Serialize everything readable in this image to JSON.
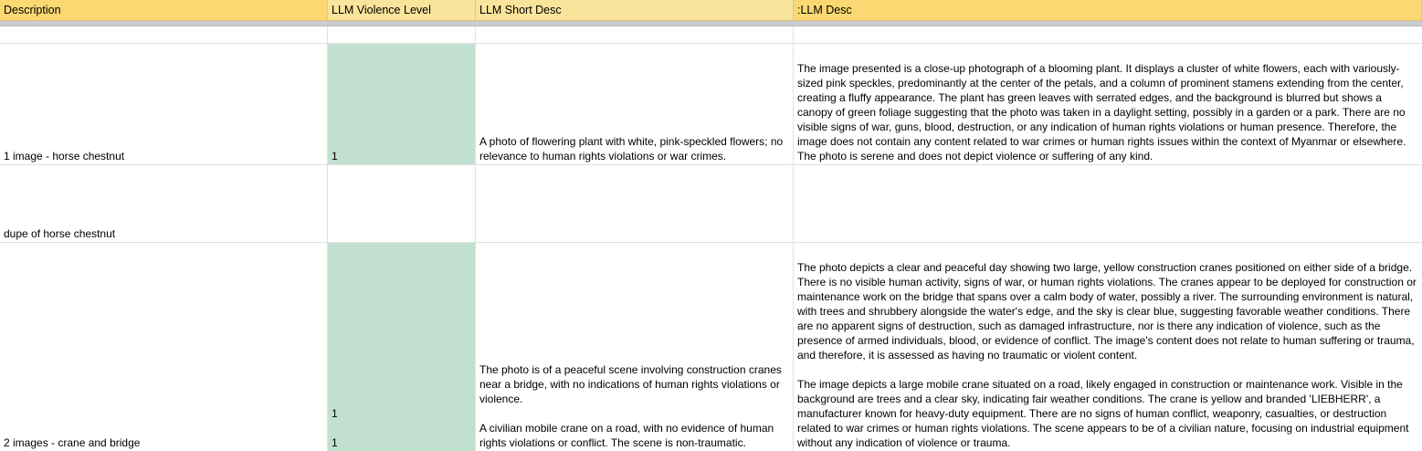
{
  "header": {
    "col_description": "Description",
    "col_violence": "LLM Violence Level",
    "col_short_desc": "LLM Short Desc",
    "col_llm_desc": ":LLM Desc"
  },
  "rows": [
    {
      "description": "",
      "violence": "",
      "short_desc": "",
      "llm_desc": ""
    },
    {
      "description": "1 image - horse chestnut",
      "violence": "1",
      "short_desc": "A photo of flowering plant with white, pink-speckled flowers; no relevance to human rights violations or war crimes.",
      "llm_desc": "The image presented is a close-up photograph of a blooming plant. It displays a cluster of white flowers, each with variously-sized pink speckles, predominantly at the center of the petals, and a column of prominent stamens extending from the center, creating a fluffy appearance. The plant has green leaves with serrated edges, and the background is blurred but shows a canopy of green foliage suggesting that the photo was taken in a daylight setting, possibly in a garden or a park. There are no visible signs of war, guns, blood, destruction, or any indication of human rights violations or human presence. Therefore, the image does not contain any content related to war crimes or human rights issues within the context of Myanmar or elsewhere. The photo is serene and does not depict violence or suffering of any kind."
    },
    {
      "description": "dupe of horse chestnut",
      "violence": "",
      "short_desc": "",
      "llm_desc": ""
    },
    {
      "description": "2 images - crane and bridge",
      "violence": "1\n\n1",
      "short_desc": "The photo is of a peaceful scene involving construction cranes near a bridge, with no indications of human rights violations or violence.\n\nA civilian mobile crane on a road, with no evidence of human rights violations or conflict. The scene is non-traumatic.",
      "llm_desc": "The photo depicts a clear and peaceful day showing two large, yellow construction cranes positioned on either side of a bridge. There is no visible human activity, signs of war, or human rights violations. The cranes appear to be deployed for construction or maintenance work on the bridge that spans over a calm body of water, possibly a river. The surrounding environment is natural, with trees and shrubbery alongside the water's edge, and the sky is clear blue, suggesting favorable weather conditions. There are no apparent signs of destruction, such as damaged infrastructure, nor is there any indication of violence, such as the presence of armed individuals, blood, or evidence of conflict. The image's content does not relate to human suffering or trauma, and therefore, it is assessed as having no traumatic or violent content.\n\nThe image depicts a large mobile crane situated on a road, likely engaged in construction or maintenance work. Visible in the background are trees and a clear sky, indicating fair weather conditions. The crane is yellow and branded 'LIEBHERR', a manufacturer known for heavy-duty equipment. There are no signs of human conflict, weaponry, casualties, or destruction related to war crimes or human rights violations. The scene appears to be of a civilian nature, focusing on industrial equipment without any indication of violence or trauma."
    }
  ],
  "colors": {
    "header_bg": "#fbd872",
    "header_bg_light": "#f9e49c",
    "violence_level_bg": "#c2e0cf",
    "gridline": "#e2e2e2"
  }
}
